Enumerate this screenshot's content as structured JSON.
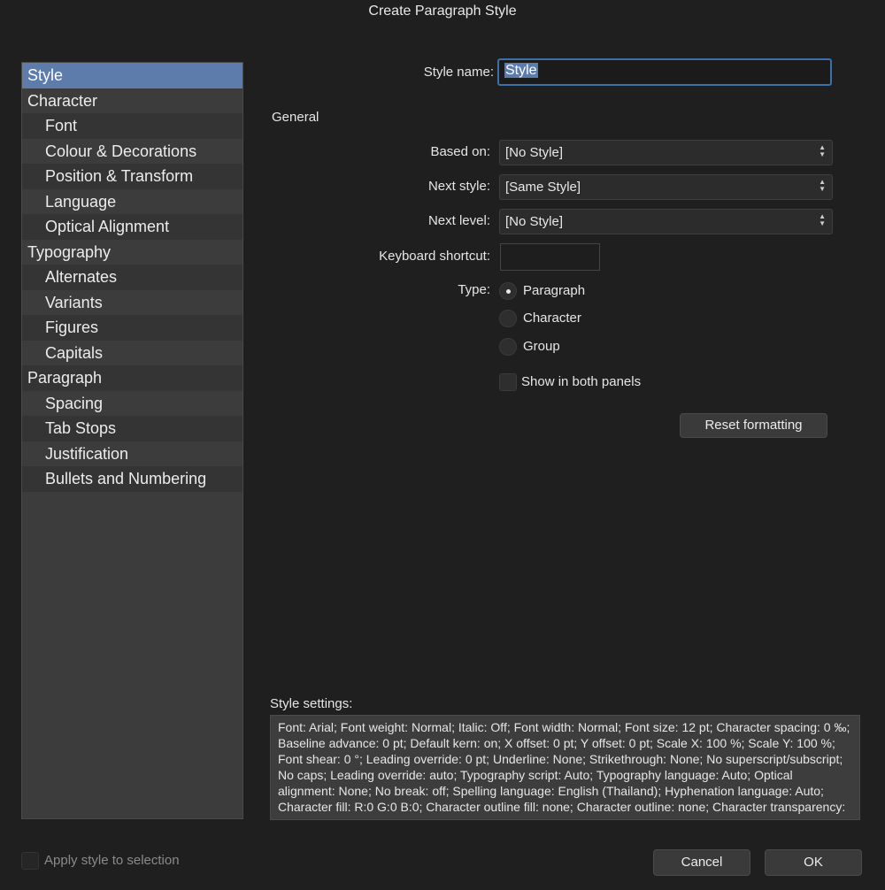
{
  "window": {
    "title": "Create Paragraph Style"
  },
  "sidebar": {
    "items": [
      {
        "label": "Style",
        "level": 0,
        "selected": true
      },
      {
        "label": "Character",
        "level": 0
      },
      {
        "label": "Font",
        "level": 1
      },
      {
        "label": "Colour & Decorations",
        "level": 1
      },
      {
        "label": "Position & Transform",
        "level": 1
      },
      {
        "label": "Language",
        "level": 1
      },
      {
        "label": "Optical Alignment",
        "level": 1
      },
      {
        "label": "Typography",
        "level": 0
      },
      {
        "label": "Alternates",
        "level": 1
      },
      {
        "label": "Variants",
        "level": 1
      },
      {
        "label": "Figures",
        "level": 1
      },
      {
        "label": "Capitals",
        "level": 1
      },
      {
        "label": "Paragraph",
        "level": 0
      },
      {
        "label": "Spacing",
        "level": 1
      },
      {
        "label": "Tab Stops",
        "level": 1
      },
      {
        "label": "Justification",
        "level": 1
      },
      {
        "label": "Bullets and Numbering",
        "level": 1
      }
    ]
  },
  "form": {
    "style_name_label": "Style name:",
    "style_name_value": "Style",
    "section_general": "General",
    "based_on_label": "Based on:",
    "based_on_value": "[No Style]",
    "next_style_label": "Next style:",
    "next_style_value": "[Same Style]",
    "next_level_label": "Next level:",
    "next_level_value": "[No Style]",
    "keyboard_shortcut_label": "Keyboard shortcut:",
    "keyboard_shortcut_value": "",
    "type_label": "Type:",
    "type_options": [
      "Paragraph",
      "Character",
      "Group"
    ],
    "type_selected": "Paragraph",
    "show_both_panels_label": "Show in both panels",
    "show_both_panels_checked": false,
    "reset_button": "Reset formatting"
  },
  "settings": {
    "label": "Style settings:",
    "text": "Font: Arial; Font weight: Normal; Italic: Off; Font width: Normal; Font size: 12 pt; Character spacing: 0 ‰; Baseline advance: 0 pt; Default kern: on; X offset: 0 pt; Y offset: 0 pt; Scale X: 100 %; Scale Y: 100 %; Font shear: 0 °; Leading override: 0 pt; Underline: None; Strikethrough: None; No superscript/subscript; No caps; Leading override: auto; Typography script: Auto; Typography language: Auto; Optical alignment: None; No break: off; Spelling language: English (Thailand); Hyphenation language: Auto; Character fill: R:0 G:0 B:0; Character outline fill: none; Character outline: none; Character transparency:"
  },
  "footer": {
    "apply_label": "Apply style to selection",
    "apply_checked": false,
    "cancel_button": "Cancel",
    "ok_button": "OK"
  },
  "colors": {
    "background": "#1f1f1f",
    "sidebar_bg": "#3c3c3c",
    "selection": "#5d7bab",
    "focus_ring": "#3d6fa8"
  }
}
